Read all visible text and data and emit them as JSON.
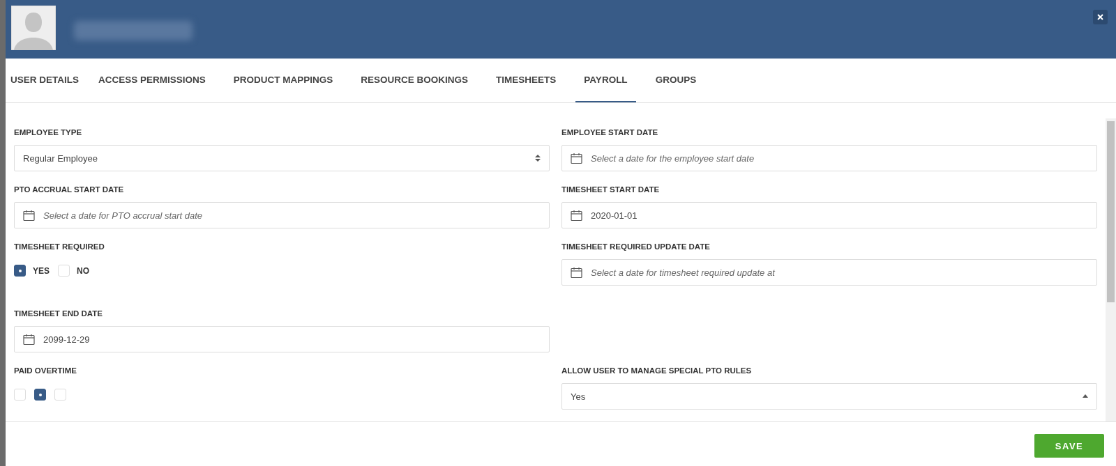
{
  "tabs": [
    {
      "label": "USER DETAILS",
      "selected": false
    },
    {
      "label": "ACCESS PERMISSIONS",
      "selected": false
    },
    {
      "label": "PRODUCT MAPPINGS",
      "selected": false
    },
    {
      "label": "RESOURCE BOOKINGS",
      "selected": false
    },
    {
      "label": "TIMESHEETS",
      "selected": false
    },
    {
      "label": "PAYROLL",
      "selected": true
    },
    {
      "label": "GROUPS",
      "selected": false
    }
  ],
  "fields": [
    {
      "kind": "select",
      "label": "EMPLOYEE TYPE",
      "value": "Regular Employee",
      "open": false
    },
    {
      "kind": "date",
      "label": "EMPLOYEE START DATE",
      "placeholder": "Select a date for the employee start date"
    },
    {
      "kind": "date",
      "label": "PTO ACCRUAL START DATE",
      "placeholder": "Select a date for PTO accrual start date"
    },
    {
      "kind": "date",
      "label": "TIMESHEET START DATE",
      "value": "2020-01-01"
    },
    {
      "kind": "radio",
      "label": "TIMESHEET REQUIRED",
      "options": [
        {
          "label": "YES",
          "selected": true
        },
        {
          "label": "NO",
          "selected": false
        }
      ]
    },
    {
      "kind": "date",
      "label": "TIMESHEET REQUIRED UPDATE DATE",
      "placeholder": "Select a date for timesheet required update at"
    },
    {
      "kind": "date",
      "label": "TIMESHEET END DATE",
      "value": "2099-12-29"
    },
    {
      "kind": "empty"
    },
    {
      "kind": "radio",
      "label": "PAID OVERTIME",
      "options": [
        {
          "selected": false
        },
        {
          "selected": true
        },
        {
          "selected": false
        }
      ]
    },
    {
      "kind": "select",
      "label": "ALLOW USER TO MANAGE SPECIAL PTO RULES",
      "value": "Yes",
      "open": true
    }
  ],
  "save_button": "SAVE"
}
